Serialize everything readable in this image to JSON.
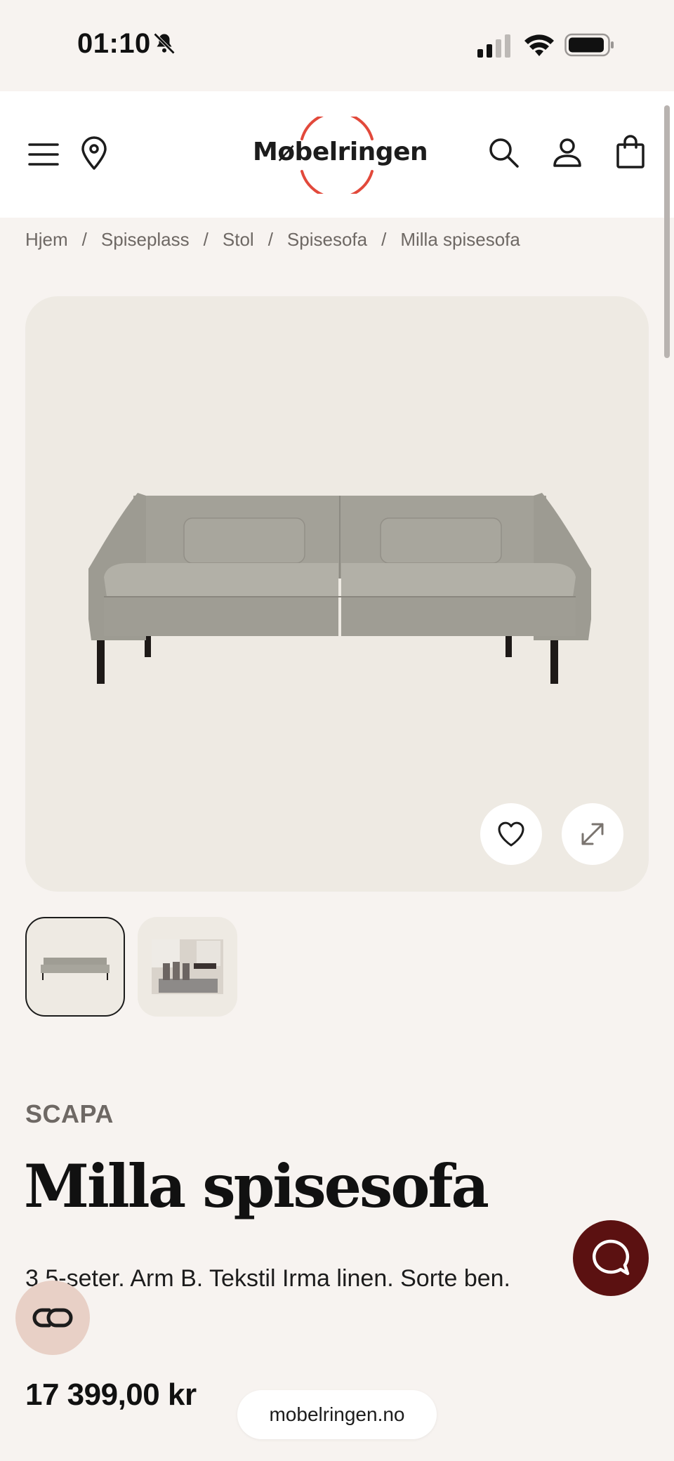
{
  "status_bar": {
    "time": "01:10",
    "icons": [
      "bell-slash-icon",
      "cellular-signal-icon",
      "wifi-icon",
      "battery-icon"
    ]
  },
  "header": {
    "logo_text": "Møbelringen",
    "icons": [
      "menu-icon",
      "location-pin-icon",
      "search-icon",
      "account-icon",
      "shopping-bag-icon"
    ],
    "logo_ring_color": "#e2493b"
  },
  "breadcrumb": [
    "Hjem",
    "Spiseplass",
    "Stol",
    "Spisesofa",
    "Milla spisesofa"
  ],
  "breadcrumb_separator": "/",
  "gallery": {
    "main_image": "grey-sofa-product-photo",
    "thumbnails": [
      "sofa-thumbnail",
      "dining-room-thumbnail"
    ],
    "selected_thumbnail": 0,
    "actions": [
      "heart-icon",
      "expand-icon"
    ]
  },
  "product": {
    "brand": "SCAPA",
    "title": "Milla spisesofa",
    "description": "3,5-seter. Arm B. Tekstil Irma linen. Sorte ben.",
    "price": "17 399,00 kr"
  },
  "floating": {
    "chat_icon": "chat-bubble-icon",
    "scandit_icon": "link-icon",
    "url": "mobelringen.no"
  },
  "colors": {
    "background": "#f7f3f0",
    "header": "#ffffff",
    "image_bg": "#eeeae3",
    "chat_button": "#5b1111",
    "accent_red": "#e2493b"
  }
}
